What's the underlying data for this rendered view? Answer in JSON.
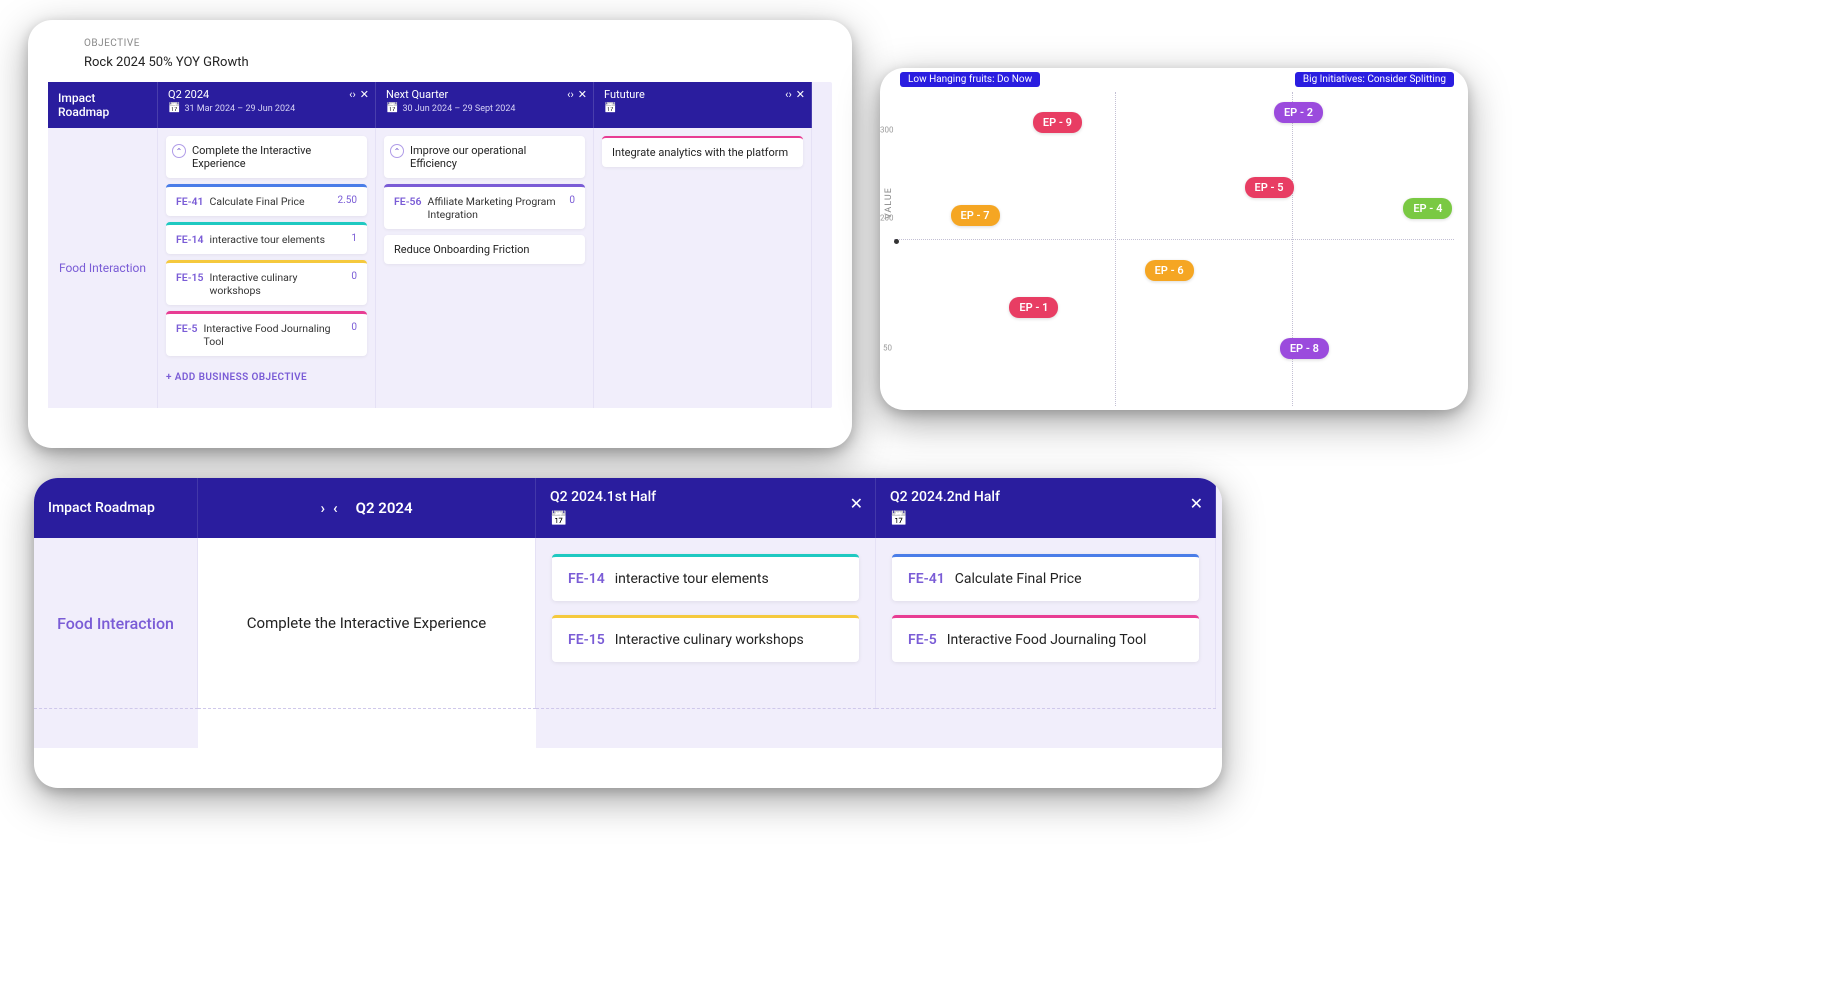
{
  "card1": {
    "objective_label": "OBJECTIVE",
    "objective_title": "Rock 2024 50% YOY GRowth",
    "roadmap_title": "Impact Roadmap",
    "columns": [
      {
        "title": "Q2 2024",
        "dates": "31 Mar 2024 – 29 Jun 2024"
      },
      {
        "title": "Next Quarter",
        "dates": "30 Jun 2024 – 29 Sept 2024"
      },
      {
        "title": "Fututure",
        "dates": ""
      }
    ],
    "lane_label": "Food Interaction",
    "col1_kr": "Complete the Interactive Experience",
    "col1_tasks": [
      {
        "id": "FE-41",
        "title": "Calculate Final Price",
        "score": "2.50",
        "color": "blue"
      },
      {
        "id": "FE-14",
        "title": "interactive tour elements",
        "score": "1",
        "color": "teal"
      },
      {
        "id": "FE-15",
        "title": "Interactive culinary workshops",
        "score": "0",
        "color": "yellow"
      },
      {
        "id": "FE-5",
        "title": "Interactive Food Journaling Tool",
        "score": "0",
        "color": "pink"
      }
    ],
    "col2_kr1": "Improve our operational Efficiency",
    "col2_tasks": [
      {
        "id": "FE-56",
        "title": "Affiliate Marketing Program Integration",
        "score": "0",
        "color": "purple"
      }
    ],
    "col2_kr2": "Reduce Onboarding Friction",
    "col3_kr": "Integrate analytics with the platform",
    "add_label": "+ ADD BUSINESS OBJECTIVE"
  },
  "chart_data": {
    "type": "scatter",
    "title": "",
    "xlabel": "",
    "ylabel": "VALUE",
    "ylim": [
      0,
      400
    ],
    "xlim": [
      0,
      100
    ],
    "yticks": [
      50,
      200,
      300
    ],
    "annotations": [
      {
        "text": "Low Hanging fruits: Do Now",
        "pos": "top-left"
      },
      {
        "text": "Big Initiatives: Consider Splitting",
        "pos": "top-right"
      }
    ],
    "points": [
      {
        "name": "EP - 9",
        "x": 28,
        "y": 355,
        "color": "pink"
      },
      {
        "name": "EP - 2",
        "x": 70,
        "y": 370,
        "color": "purple"
      },
      {
        "name": "EP - 7",
        "x": 14,
        "y": 240,
        "color": "orange"
      },
      {
        "name": "EP - 5",
        "x": 64,
        "y": 275,
        "color": "pink"
      },
      {
        "name": "EP - 4",
        "x": 94,
        "y": 248,
        "color": "green"
      },
      {
        "name": "EP - 6",
        "x": 48,
        "y": 172,
        "color": "orange"
      },
      {
        "name": "EP - 1",
        "x": 24,
        "y": 122,
        "color": "pink"
      },
      {
        "name": "EP - 8",
        "x": 72,
        "y": 70,
        "color": "purple"
      }
    ]
  },
  "card3": {
    "roadmap_title": "Impact Roadmap",
    "period": "Q2 2024",
    "cols": [
      {
        "title": "Q2 2024.1st Half"
      },
      {
        "title": "Q2 2024.2nd Half"
      }
    ],
    "lane_label": "Food Interaction",
    "desc": "Complete the Interactive Experience",
    "col1_tasks": [
      {
        "id": "FE-14",
        "title": "interactive tour elements",
        "color": "teal"
      },
      {
        "id": "FE-15",
        "title": "Interactive culinary workshops",
        "color": "yellow"
      }
    ],
    "col2_tasks": [
      {
        "id": "FE-41",
        "title": "Calculate Final Price",
        "color": "blue"
      },
      {
        "id": "FE-5",
        "title": "Interactive Food Journaling Tool",
        "color": "pink"
      }
    ]
  }
}
